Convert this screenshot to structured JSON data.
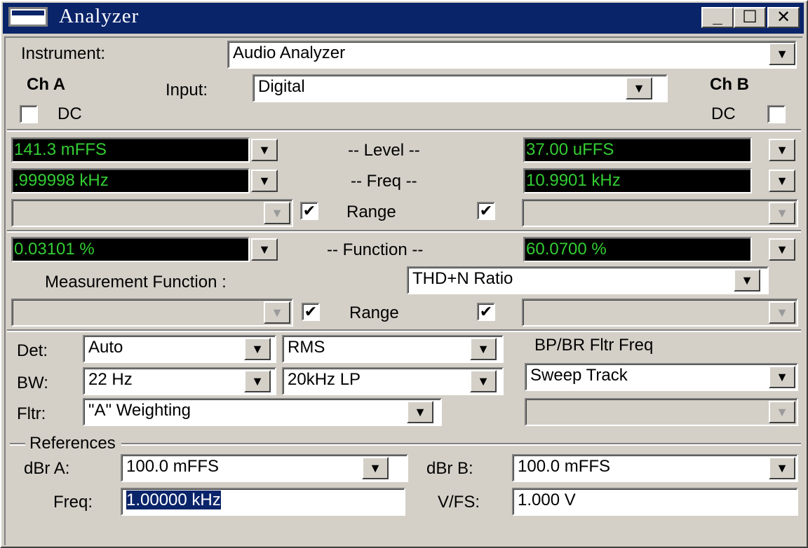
{
  "window": {
    "title": "Analyzer"
  },
  "titlebar": {
    "minimize_glyph": "_",
    "maximize_glyph": "☐",
    "close_glyph": "✕"
  },
  "icons": {
    "dropdown": "▼",
    "check": "✔"
  },
  "instrument": {
    "label": "Instrument:",
    "value": "Audio Analyzer"
  },
  "channel": {
    "a_label": "Ch A",
    "b_label": "Ch B",
    "input_label": "Input:",
    "input_value": "Digital",
    "dc_a_label": "DC",
    "dc_b_label": "DC",
    "dc_a_checked": false,
    "dc_b_checked": false
  },
  "readouts": {
    "level_label": "-- Level --",
    "level_a": "141.3  mFFS",
    "level_b": "37.00  uFFS",
    "freq_label": "-- Freq --",
    "freq_a": ".999998 kHz",
    "freq_b": "10.9901 kHz",
    "range_label": "Range",
    "range_a_checked": true,
    "range_b_checked": true,
    "function_label": "-- Function --",
    "function_a": "0.03101  %",
    "function_b": "60.0700  %",
    "range2_label": "Range",
    "range2_a_checked": true,
    "range2_b_checked": true
  },
  "measurement": {
    "label": "Measurement Function :",
    "value": "THD+N Ratio"
  },
  "detector": {
    "det_label": "Det:",
    "det_value": "Auto",
    "det_mode": "RMS",
    "bw_label": "BW:",
    "bw_value": "22 Hz",
    "bw_filter": "20kHz LP",
    "fltr_label": "Fltr:",
    "fltr_value": "\"A\" Weighting",
    "bp_label": "BP/BR Fltr Freq",
    "bp_value": "Sweep Track"
  },
  "references": {
    "group_label": "References",
    "dbr_a_label": "dBr A:",
    "dbr_a_value": "100.0   mFFS",
    "dbr_b_label": "dBr B:",
    "dbr_b_value": "100.0   mFFS",
    "freq_label": "Freq:",
    "freq_value": "1.00000 kHz",
    "vfs_label": "V/FS:",
    "vfs_value": "1.000    V"
  },
  "colors": {
    "titlebar": "#0a246a",
    "readout_bg": "#000000",
    "readout_fg": "#33cc33",
    "face": "#d4d0c8"
  }
}
